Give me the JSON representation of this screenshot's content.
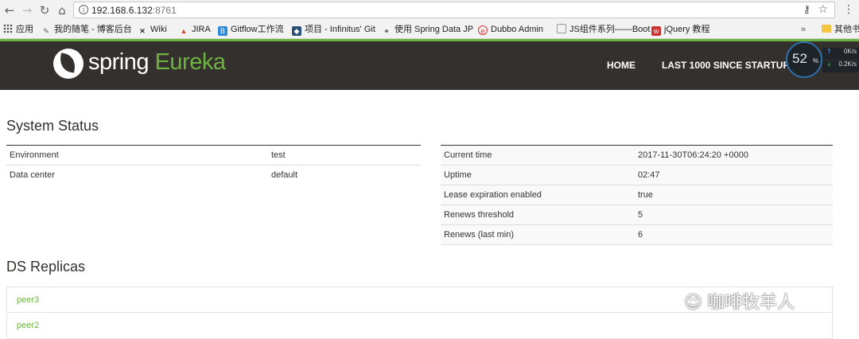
{
  "browser": {
    "url_host": "192.168.6.132",
    "url_port": ":8761",
    "bookmarks": [
      {
        "label": "应用",
        "icon": "apps-icon"
      },
      {
        "label": "我的随笔 - 博客后台",
        "icon": "pencil-icon"
      },
      {
        "label": "Wiki",
        "icon": "wiki-icon"
      },
      {
        "label": "JIRA",
        "icon": "jira-icon"
      },
      {
        "label": "Gitflow工作流",
        "icon": "bookmark-b-icon"
      },
      {
        "label": "项目 - Infinitus' Git",
        "icon": "git-shield-icon"
      },
      {
        "label": "使用 Spring Data JP",
        "icon": "link-icon"
      },
      {
        "label": "Dubbo Admin",
        "icon": "dubbo-icon"
      },
      {
        "label": "JS组件系列——Boot",
        "icon": "page-icon"
      },
      {
        "label": "jQuery 教程",
        "icon": "w3-icon"
      },
      {
        "label": "其他书",
        "icon": "folder-icon"
      }
    ],
    "overflow": "»"
  },
  "header": {
    "logo_word1": "spring",
    "logo_word2": "Eureka",
    "nav": [
      "HOME",
      "LAST 1000 SINCE STARTUP"
    ]
  },
  "net_widget": {
    "percent": "52",
    "percent_unit": "%",
    "up": "0K/s",
    "down": "0.2K/s",
    "colors": {
      "ring": "#2d6fa8",
      "up_arrow": "#4a9fe0",
      "down_arrow": "#4caf50"
    }
  },
  "system_status": {
    "title": "System Status",
    "left": [
      {
        "key": "Environment",
        "value": "test"
      },
      {
        "key": "Data center",
        "value": "default"
      }
    ],
    "right": [
      {
        "key": "Current time",
        "value": "2017-11-30T06:24:20 +0000"
      },
      {
        "key": "Uptime",
        "value": "02:47"
      },
      {
        "key": "Lease expiration enabled",
        "value": "true"
      },
      {
        "key": "Renews threshold",
        "value": "5"
      },
      {
        "key": "Renews (last min)",
        "value": "6"
      }
    ]
  },
  "replicas": {
    "title": "DS Replicas",
    "items": [
      "peer3",
      "peer2"
    ]
  },
  "watermark": {
    "text": "咖啡牧羊人"
  },
  "colors": {
    "spring_green": "#6db33f",
    "header_bg": "#34302d"
  }
}
